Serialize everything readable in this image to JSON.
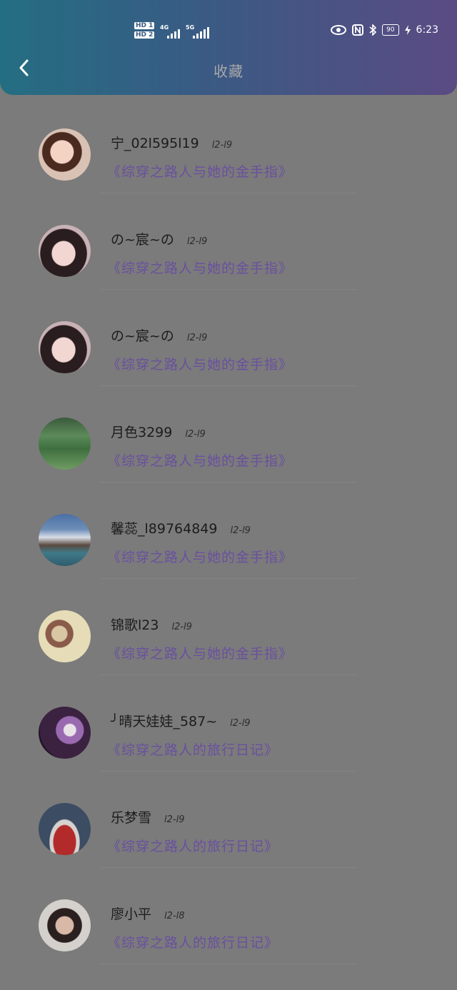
{
  "status_bar": {
    "sim1": "HD 1",
    "sim2": "HD 2",
    "net1": "4G",
    "net2": "5G",
    "battery": "90",
    "time": "6:23"
  },
  "header": {
    "title": "收藏"
  },
  "favorites": [
    {
      "name": "宁_02l595l19",
      "date": "l2-l9",
      "book": "《综穿之路人与她的金手指》"
    },
    {
      "name": "の~宸~の",
      "date": "l2-l9",
      "book": "《综穿之路人与她的金手指》"
    },
    {
      "name": "の~宸~の",
      "date": "l2-l9",
      "book": "《综穿之路人与她的金手指》"
    },
    {
      "name": "月色3299",
      "date": "l2-l9",
      "book": "《综穿之路人与她的金手指》"
    },
    {
      "name": "馨蕊_l89764849",
      "date": "l2-l9",
      "book": "《综穿之路人与她的金手指》"
    },
    {
      "name": "锦歌l23",
      "date": "l2-l9",
      "book": "《综穿之路人与她的金手指》"
    },
    {
      "name": "╯晴天娃娃_587~",
      "date": "l2-l9",
      "book": "《综穿之路人的旅行日记》"
    },
    {
      "name": "乐梦雪",
      "date": "l2-l9",
      "book": "《综穿之路人的旅行日记》"
    },
    {
      "name": "廖小平",
      "date": "l2-l8",
      "book": "《综穿之路人的旅行日记》"
    }
  ]
}
